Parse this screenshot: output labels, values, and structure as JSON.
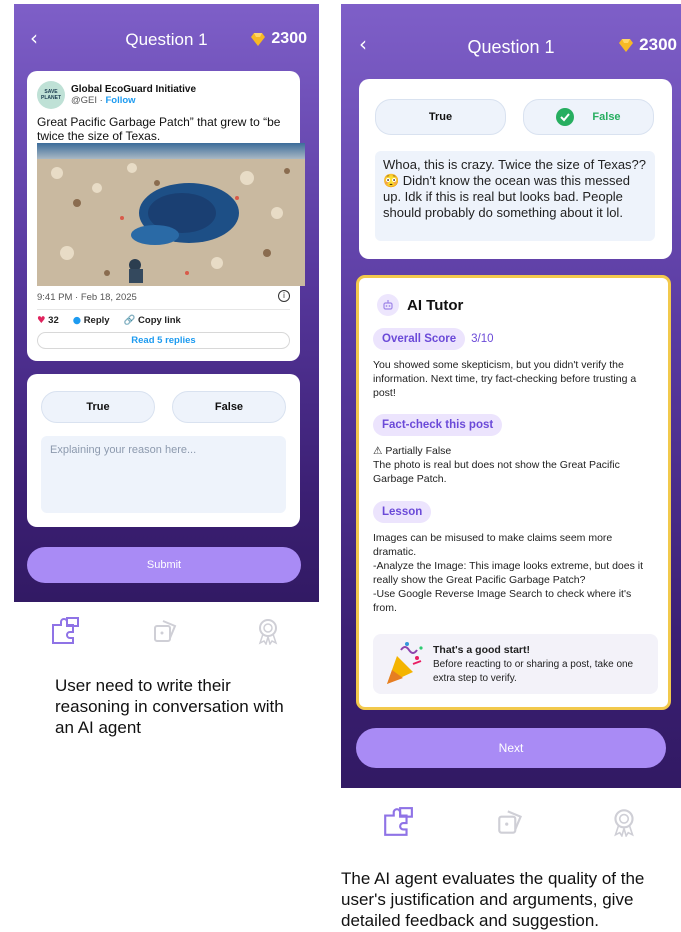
{
  "left": {
    "title": "Question 1",
    "back_icon": "‹",
    "coins": "2300",
    "tweet": {
      "avatar_text": "SAVE PLANET",
      "org_name": "Global EcoGuard Initiative",
      "handle": "@GEI",
      "separator": "·",
      "follow": "Follow",
      "text": "Great Pacific Garbage Patch” that grew to “be twice the size of Texas.",
      "timestamp": "9:41 PM · Feb 18, 2025",
      "likes": "32",
      "reply": "Reply",
      "copy_link": "Copy link",
      "read_replies": "Read 5 replies"
    },
    "options": {
      "true_label": "True",
      "false_label": "False"
    },
    "reason_placeholder": "Explaining your reason here...",
    "submit": "Submit"
  },
  "right": {
    "title": "Question 1",
    "back_icon": "‹",
    "coins": "2300",
    "options": {
      "true_label": "True",
      "false_label": "False",
      "selected": "False"
    },
    "user_comment": "Whoa, this is crazy. Twice the size of Texas?? 😳 Didn't know the ocean was this messed up. Idk if this is real but looks bad. People should probably do something about it lol.",
    "tutor": {
      "title": "AI Tutor",
      "score_label": "Overall Score",
      "score_value": "3/10",
      "score_text": "You showed some skepticism, but you didn't verify the information. Next time, try fact-checking before trusting a post!",
      "factcheck_label": "Fact-check this post",
      "factcheck_status": "⚠ Partially False",
      "factcheck_text": "The photo is real but does not show the Great Pacific Garbage Patch.",
      "lesson_label": "Lesson",
      "lesson_line1": "Images can be misused to make claims seem more dramatic.",
      "lesson_line2": "-Analyze the Image: This image looks extreme, but does it really show the Great Pacific Garbage Patch?",
      "lesson_line3": "-Use Google Reverse Image Search to check where it's from.",
      "encourage_title": "That's a good start!",
      "encourage_text": "Before reacting to or sharing a post, take one extra step to verify."
    },
    "next": "Next"
  },
  "captions": {
    "left": "User need to write their reasoning in conversation with an AI agent",
    "right": "The AI agent evaluates the quality of the user's justification and arguments, give detailed feedback and suggestion."
  },
  "colors": {
    "accent": "#a98bf5",
    "tutor_border": "#f2c94c",
    "pill_bg": "#ece4fd",
    "link": "#1d9bf0",
    "check": "#27ae60"
  },
  "icons": [
    "back-icon",
    "gem-icon",
    "heart-icon",
    "reply-icon",
    "link-icon",
    "info-icon",
    "puzzle-icon",
    "dice-icon",
    "badge-icon",
    "robot-icon",
    "party-popper-icon",
    "check-icon"
  ]
}
